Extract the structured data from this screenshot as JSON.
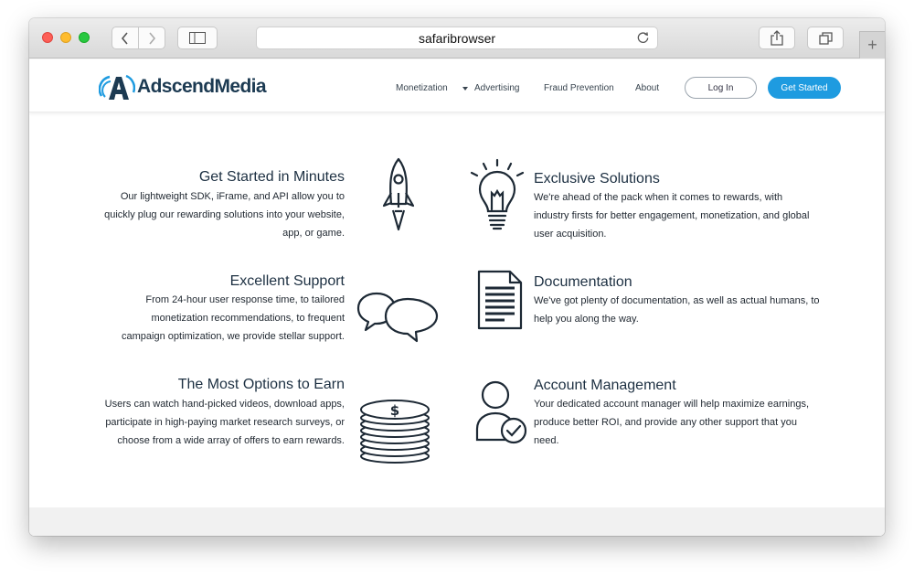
{
  "browser": {
    "address": "safaribrowser",
    "toolbar_icons": [
      "back-icon",
      "forward-icon",
      "sidebar-icon",
      "reload-icon",
      "share-icon",
      "tabs-icon",
      "new-tab-icon"
    ]
  },
  "site": {
    "logo_text": "AdscendMedia",
    "nav": {
      "monetization": "Monetization",
      "advertising": "Advertising",
      "fraud_prevention": "Fraud Prevention",
      "about": "About"
    },
    "login_label": "Log In",
    "get_started_label": "Get Started",
    "accent_color": "#1e9be0",
    "brand_color": "#1c3a52"
  },
  "features": {
    "get_started": {
      "title": "Get Started in Minutes",
      "lines": [
        "Our lightweight SDK, iFrame, and API allow you to",
        "quickly plug our rewarding solutions into your website,",
        "app, or game."
      ],
      "icon": "rocket-icon"
    },
    "exclusive": {
      "title": "Exclusive Solutions",
      "lines": [
        "We're ahead of the pack when it comes to rewards, with",
        "industry firsts for better engagement, monetization, and global",
        "user acquisition."
      ],
      "icon": "lightbulb-icon"
    },
    "support": {
      "title": "Excellent Support",
      "lines": [
        "From 24-hour user response time, to tailored",
        "monetization recommendations, to frequent",
        "campaign optimization, we provide stellar support."
      ],
      "icon": "chat-bubbles-icon"
    },
    "documentation": {
      "title": "Documentation",
      "lines": [
        "We've got plenty of documentation, as well as actual humans, to",
        "help you along the way."
      ],
      "icon": "document-icon"
    },
    "options": {
      "title": "The Most Options to Earn",
      "lines": [
        "Users can watch hand-picked videos, download apps,",
        "participate in high-paying market research surveys, or",
        "choose from a wide array of offers to earn rewards."
      ],
      "icon": "coin-stack-icon"
    },
    "account": {
      "title": "Account Management",
      "lines": [
        "Your dedicated account manager will help maximize earnings,",
        "produce better ROI, and provide any other support that you",
        "need."
      ],
      "icon": "account-manager-icon"
    }
  }
}
